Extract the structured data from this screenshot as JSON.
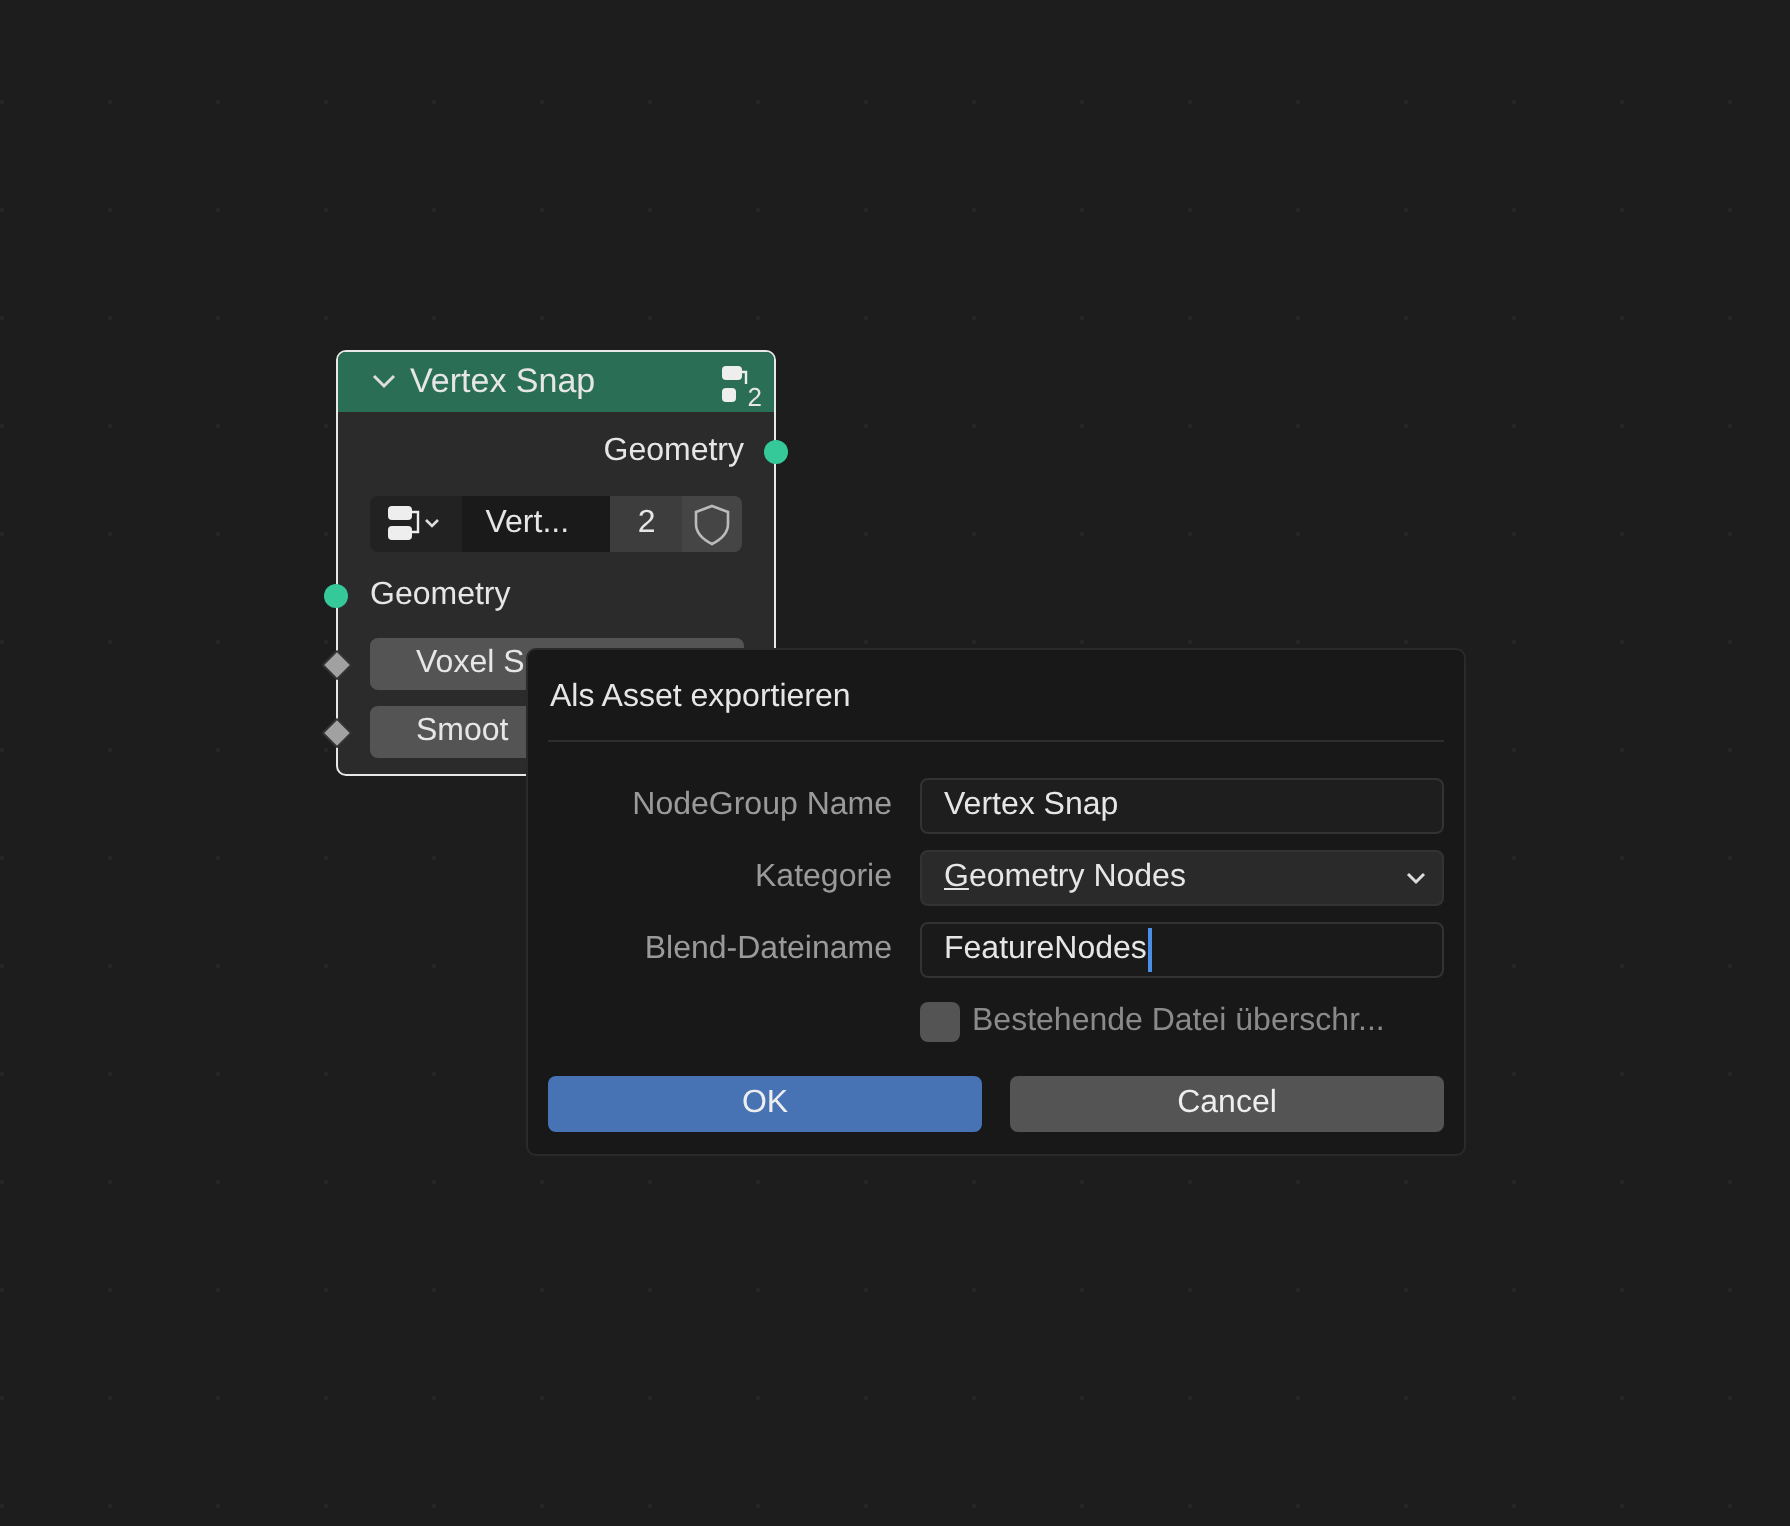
{
  "node": {
    "title": "Vertex Snap",
    "expanded": true,
    "header_users": "2",
    "outputs": [
      {
        "label": "Geometry",
        "kind": "geometry"
      }
    ],
    "group_selector": {
      "name": "Vert...",
      "users": "2",
      "fake_user": false
    },
    "inputs": [
      {
        "label": "Geometry",
        "kind": "geometry"
      },
      {
        "label": "Voxel S",
        "kind": "value"
      },
      {
        "label": "Smoot",
        "kind": "value"
      }
    ]
  },
  "dialog": {
    "title": "Als Asset exportieren",
    "fields": [
      {
        "label": "NodeGroup Name",
        "kind": "text",
        "value": "Vertex Snap",
        "focused": false
      },
      {
        "label": "Kategorie",
        "kind": "dropdown",
        "value": "Geometry Nodes",
        "focused": false
      },
      {
        "label": "Blend-Dateiname",
        "kind": "text",
        "value": "FeatureNodes",
        "focused": true
      }
    ],
    "checkbox": {
      "label": "Bestehende Datei überschr...",
      "checked": false
    },
    "buttons": [
      {
        "label": "OK",
        "kind": "primary"
      },
      {
        "label": "Cancel",
        "kind": "secondary"
      }
    ]
  }
}
